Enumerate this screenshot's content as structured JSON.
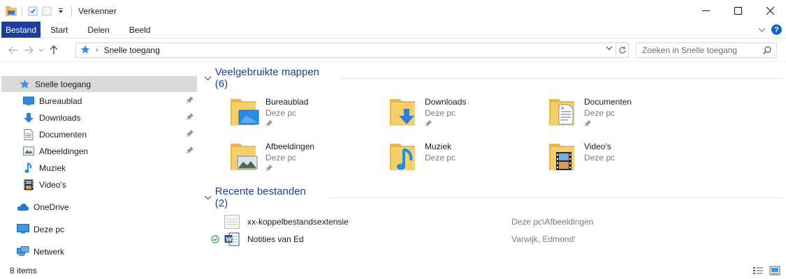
{
  "window": {
    "title": "Verkenner",
    "controls": [
      "minimize",
      "maximize",
      "close"
    ]
  },
  "ribbon": {
    "tabs": [
      "Bestand",
      "Start",
      "Delen",
      "Beeld"
    ]
  },
  "address": {
    "breadcrumb": "Snelle toegang",
    "search_placeholder": "Zoeken in Snelle toegang"
  },
  "sidebar": {
    "items": [
      {
        "label": "Snelle toegang",
        "icon": "star-icon",
        "selected": true
      },
      {
        "label": "Bureaublad",
        "icon": "desktop-icon",
        "pinned": true
      },
      {
        "label": "Downloads",
        "icon": "download-arrow-icon",
        "pinned": true
      },
      {
        "label": "Documenten",
        "icon": "document-icon",
        "pinned": true
      },
      {
        "label": "Afbeeldingen",
        "icon": "pictures-icon",
        "pinned": true
      },
      {
        "label": "Muziek",
        "icon": "music-note-icon"
      },
      {
        "label": "Video's",
        "icon": "film-icon"
      },
      {
        "label": "OneDrive",
        "icon": "cloud-icon"
      },
      {
        "label": "Deze pc",
        "icon": "computer-icon"
      },
      {
        "label": "Netwerk",
        "icon": "network-icon"
      }
    ]
  },
  "groups": {
    "frequent": {
      "title": "Veelgebruikte mappen (6)",
      "folders": [
        {
          "name": "Bureaublad",
          "location": "Deze pc",
          "pinned": true,
          "icon": "desktop-folder-icon"
        },
        {
          "name": "Downloads",
          "location": "Deze pc",
          "pinned": true,
          "icon": "downloads-folder-icon"
        },
        {
          "name": "Documenten",
          "location": "Deze pc",
          "pinned": true,
          "icon": "documents-folder-icon"
        },
        {
          "name": "Afbeeldingen",
          "location": "Deze pc",
          "pinned": true,
          "icon": "pictures-folder-icon"
        },
        {
          "name": "Muziek",
          "location": "Deze pc",
          "pinned": false,
          "icon": "music-folder-icon"
        },
        {
          "name": "Video's",
          "location": "Deze pc",
          "pinned": false,
          "icon": "videos-folder-icon"
        }
      ]
    },
    "recent": {
      "title": "Recente bestanden (2)",
      "files": [
        {
          "name": "xx-koppelbestandsextensie",
          "location": "Deze pc\\Afbeeldingen",
          "icon": "generic-file-icon",
          "synced": false
        },
        {
          "name": "Notities van Ed",
          "location": "Varwijk, Edmond'",
          "icon": "word-document-icon",
          "synced": true
        }
      ]
    }
  },
  "status": {
    "item_count": "8 items"
  },
  "colors": {
    "file_tab": "#1a3e9f",
    "group_title": "#1e3f8f",
    "selected_bg": "#d9d9d9",
    "folder_yellow": "#f0c75e"
  }
}
